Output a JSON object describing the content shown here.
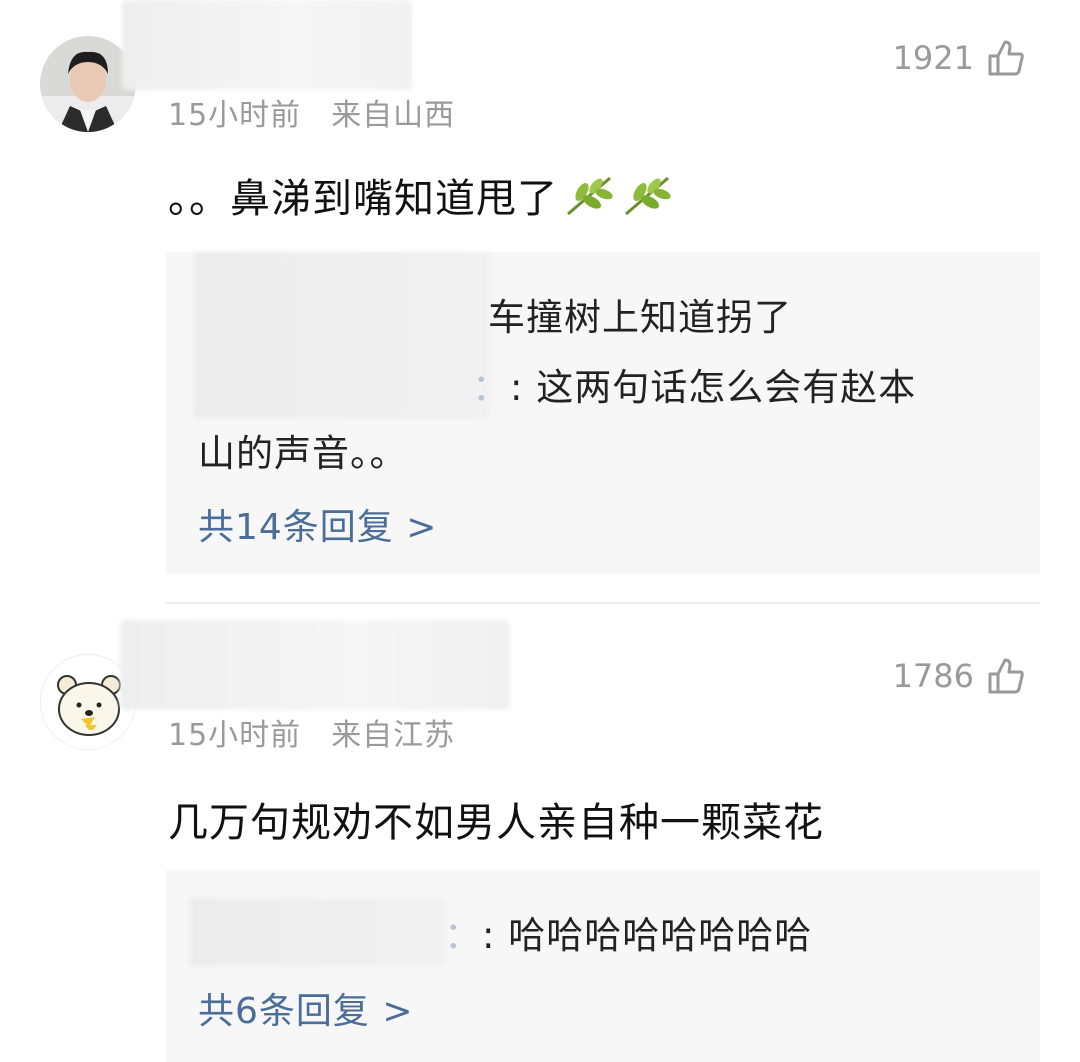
{
  "comments": [
    {
      "time": "15小时前",
      "location": "来自山西",
      "likes": "1921",
      "text": "。。鼻涕到嘴知道甩了",
      "replies": {
        "line1": "车撞树上知道拐了",
        "line2_suffix": ": 这两句话怎么会有赵本",
        "line3": "山的声音。。",
        "count": "共14条回复 >"
      }
    },
    {
      "time": "15小时前",
      "location": "来自江苏",
      "likes": "1786",
      "text": "几万句规劝不如男人亲自种一颗菜花",
      "replies": {
        "line1_suffix": ": 哈哈哈哈哈哈哈哈",
        "count": "共6条回复 >"
      }
    }
  ],
  "icons": {
    "like": "thumbs-up-icon",
    "emoji": "leaf-emoji-icon"
  },
  "colors": {
    "link": "#4a6d9a",
    "meta": "#9a9a9a",
    "reply_bg": "#f7f7f7"
  }
}
